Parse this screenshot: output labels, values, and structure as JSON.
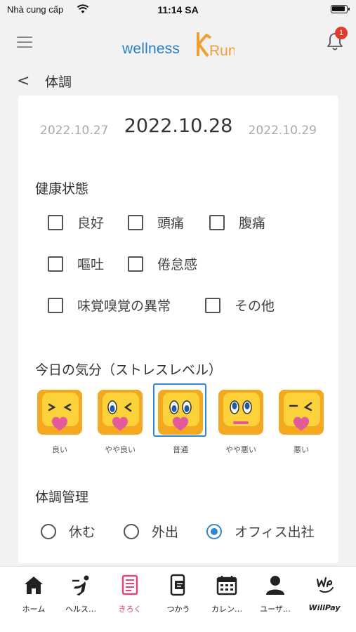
{
  "status": {
    "carrier": "Nhà cung cấp",
    "time": "11:14 SA"
  },
  "header": {
    "logo_text": "wellness",
    "logo_suffix": "Run",
    "notification_count": "1"
  },
  "page": {
    "back_symbol": "<",
    "title": "体調"
  },
  "dates": {
    "prev": "2022.10.27",
    "current": "2022.10.28",
    "next": "2022.10.29"
  },
  "health": {
    "label": "健康状態",
    "options": [
      "良好",
      "頭痛",
      "腹痛",
      "嘔吐",
      "倦怠感",
      "味覚嗅覚の異常",
      "その他"
    ]
  },
  "mood": {
    "label": "今日の気分（ストレスレベル）",
    "options": [
      {
        "label": "良い",
        "icon": "face-happy-icon"
      },
      {
        "label": "やや良い",
        "icon": "face-slightly-happy-icon"
      },
      {
        "label": "普通",
        "icon": "face-neutral-icon"
      },
      {
        "label": "やや悪い",
        "icon": "face-slightly-bad-icon"
      },
      {
        "label": "悪い",
        "icon": "face-bad-icon"
      }
    ],
    "selected": "普通"
  },
  "condition": {
    "label": "体調管理",
    "options": [
      "休む",
      "外出",
      "オフィス出社"
    ],
    "selected": "オフィス出社"
  },
  "tabs": [
    {
      "label": "ホーム",
      "icon": "home-icon"
    },
    {
      "label": "ヘルス…",
      "icon": "runner-icon"
    },
    {
      "label": "きろく",
      "icon": "record-icon"
    },
    {
      "label": "つかう",
      "icon": "phone-pay-icon"
    },
    {
      "label": "カレン…",
      "icon": "calendar-icon"
    },
    {
      "label": "ユーザ…",
      "icon": "user-icon"
    },
    {
      "label": "WillPay",
      "icon": "willpay-icon"
    }
  ],
  "colors": {
    "brand_blue": "#2a7fc1",
    "accent_orange": "#f0a030",
    "active_pink": "#e0457b",
    "selected_blue": "#2f86d4",
    "badge_red": "#e23b2e"
  }
}
